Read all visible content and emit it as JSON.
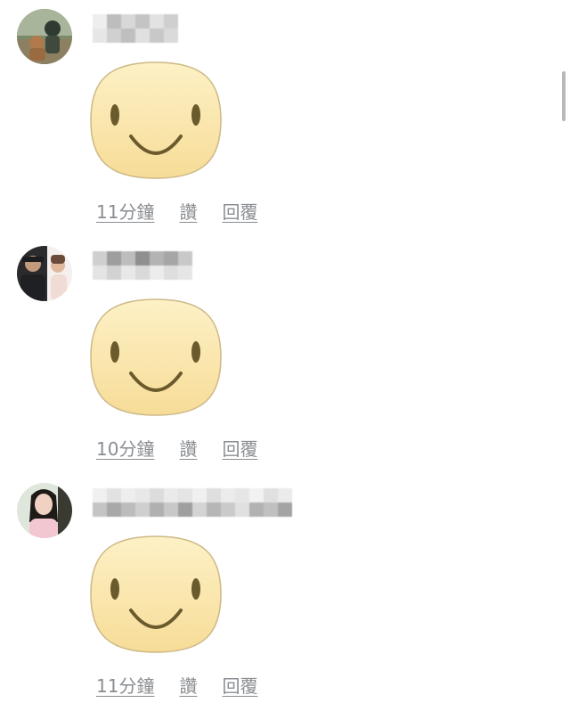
{
  "comments": [
    {
      "avatar": "user-avatar-photo",
      "name": "",
      "sticker": "smiley-face-sticker",
      "time": "11分鐘",
      "like": "讚",
      "reply": "回覆"
    },
    {
      "avatar": "user-avatar-photo",
      "name": "",
      "sticker": "smiley-face-sticker",
      "time": "10分鐘",
      "like": "讚",
      "reply": "回覆"
    },
    {
      "avatar": "user-avatar-photo",
      "name": "",
      "sticker": "smiley-face-sticker",
      "time": "11分鐘",
      "like": "讚",
      "reply": "回覆"
    }
  ],
  "colors": {
    "link_gray": "#8a8d91",
    "sticker_fill": "#fbe7b0",
    "sticker_outline": "#c9b57a",
    "sticker_features": "#6b5a2c"
  }
}
